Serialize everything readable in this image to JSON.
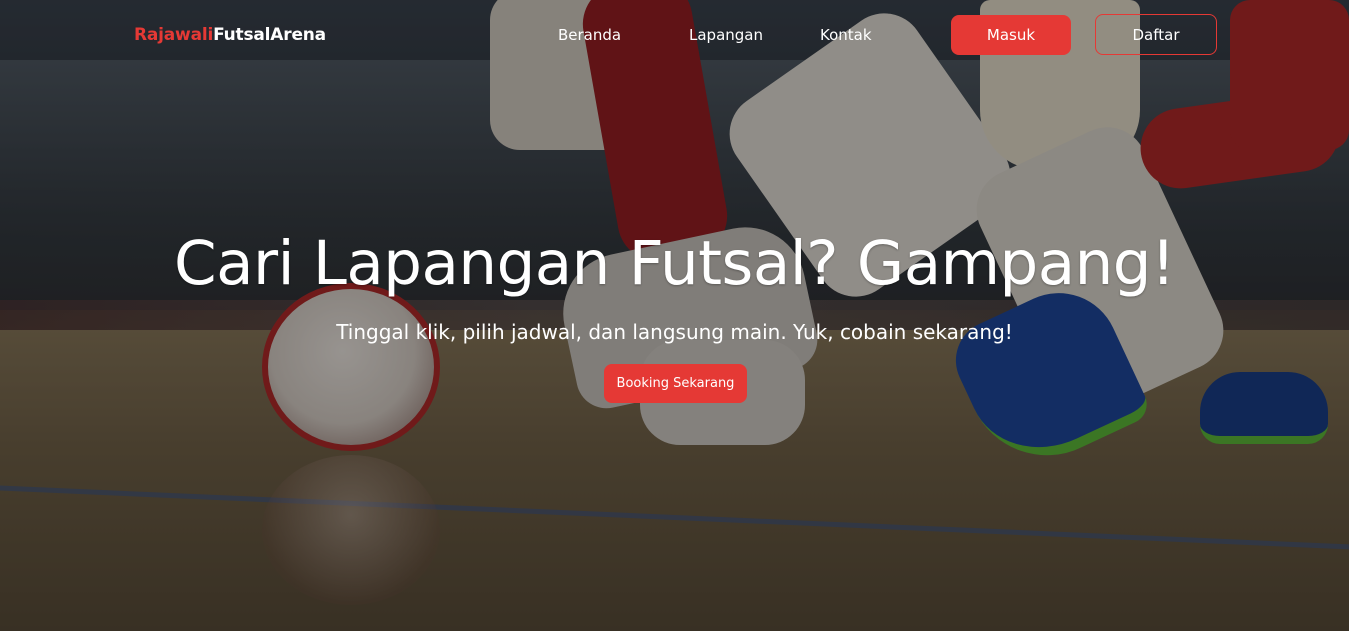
{
  "brand": {
    "part1": "Rajawali",
    "part2": "FutsalArena",
    "accent_color": "#e53935"
  },
  "nav": {
    "links": [
      {
        "label": "Beranda"
      },
      {
        "label": "Lapangan"
      },
      {
        "label": "Kontak"
      }
    ],
    "login_label": "Masuk",
    "register_label": "Daftar"
  },
  "hero": {
    "title": "Cari Lapangan Futsal? Gampang!",
    "subtitle": "Tinggal klik, pilih jadwal, dan langsung main. Yuk, cobain sekarang!",
    "cta_label": "Booking Sekarang",
    "background_image": "futsal-players-ball-photo"
  }
}
